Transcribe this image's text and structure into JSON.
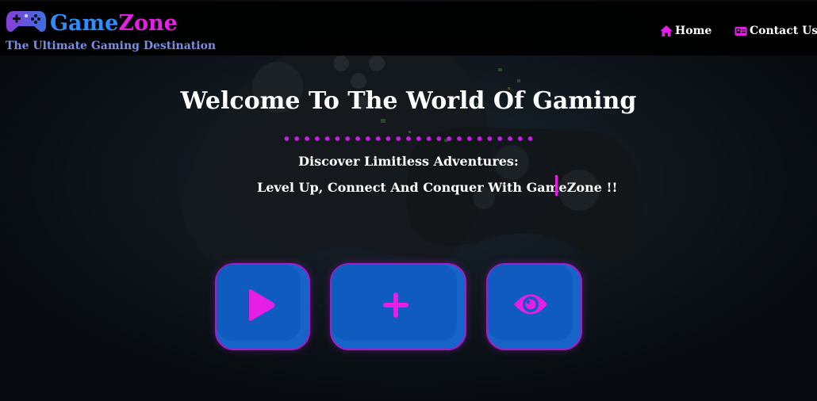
{
  "brand": {
    "name_part1": "Game",
    "name_part2": "Zone",
    "tagline": "The Ultimate Gaming Destination"
  },
  "nav": {
    "home_label": "Home",
    "contact_label": "Contact Us"
  },
  "hero": {
    "title": "Welcome To The World Of Gaming",
    "subtitle": "Discover Limitless Adventures:",
    "typed_text": "Level Up, Connect And Conquer With GameZone !!"
  },
  "icons": {
    "logo": "gamepad-icon",
    "home": "home-icon",
    "contact": "id-card-icon",
    "play": "play-icon",
    "add": "plus-icon",
    "view": "eye-icon"
  },
  "colors": {
    "accent_magenta": "#e61ee6",
    "accent_blue": "#2f8cff",
    "button_blue": "#0f5bbf",
    "tagline": "#7a8ee8"
  }
}
